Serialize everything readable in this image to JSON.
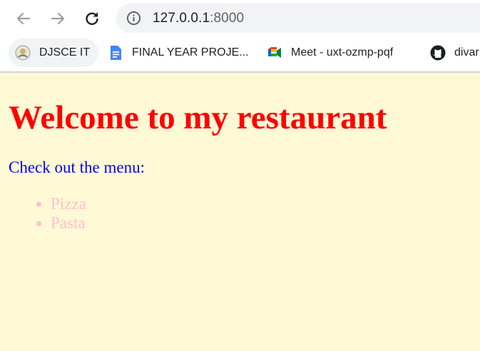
{
  "browser": {
    "address_bar": {
      "host": "127.0.0.1",
      "port": ":8000"
    },
    "bookmarks": [
      {
        "label": "DJSCE IT",
        "icon": "college-logo-icon"
      },
      {
        "label": "FINAL YEAR PROJE...",
        "icon": "google-docs-icon"
      },
      {
        "label": "Meet - uxt-ozmp-pqf",
        "icon": "google-meet-icon"
      },
      {
        "label": "divar",
        "icon": "github-icon"
      }
    ]
  },
  "page": {
    "heading": "Welcome to my restaurant",
    "intro": "Check out the menu:",
    "menu_items": [
      "Pizza",
      "Pasta"
    ],
    "colors": {
      "background": "#fff9d6",
      "heading": "#ff0000",
      "intro": "#0000ff",
      "menu_items": "#ffc0cb"
    }
  }
}
